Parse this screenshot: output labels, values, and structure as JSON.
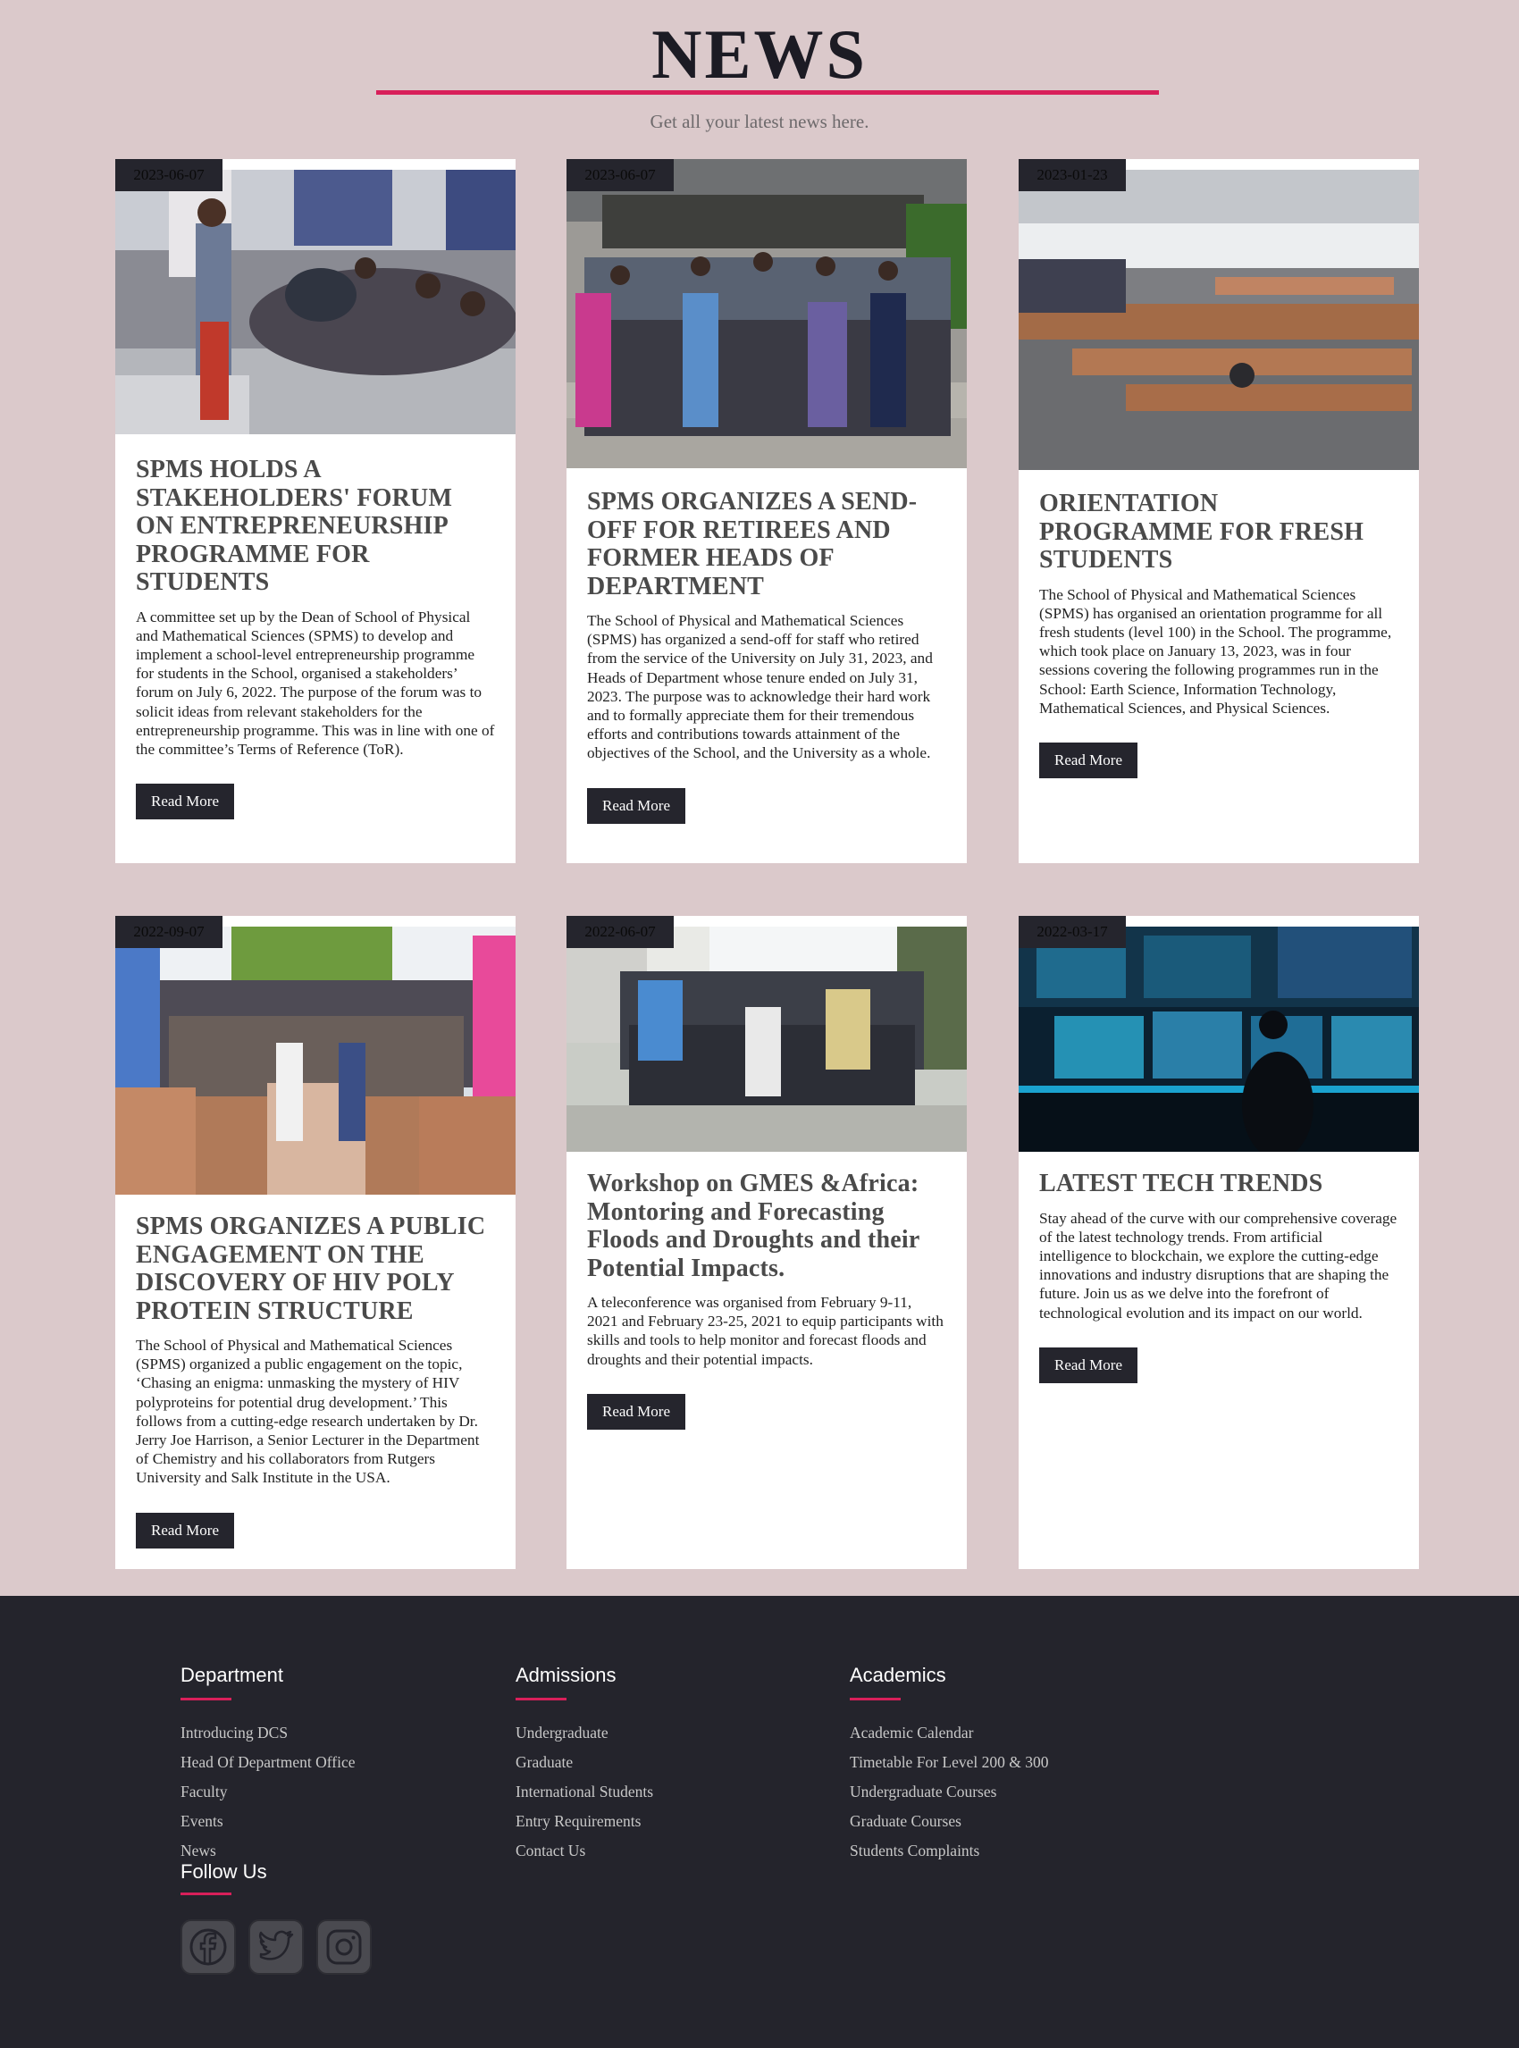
{
  "header": {
    "title": "NEWS",
    "subtitle": "Get all your latest news here."
  },
  "cards": [
    {
      "date": "2023-06-07",
      "title": "SPMS HOLDS A STAKEHOLDERS' FORUM ON ENTREPRENEURSHIP PROGRAMME FOR STUDENTS",
      "excerpt": "A committee set up by the Dean of School of Physical and Mathematical Sciences (SPMS) to develop and implement a school-level entrepreneurship programme for students in the School, organised a stakeholders’ forum on July 6, 2022. The purpose of the forum was to solicit ideas from relevant stakeholders for the entrepreneurship programme. This was in line with one of the committee’s Terms of Reference (ToR).",
      "button": "Read More"
    },
    {
      "date": "2023-06-07",
      "title": "SPMS ORGANIZES A SEND-OFF FOR RETIREES AND FORMER HEADS OF DEPARTMENT",
      "excerpt": "The School of Physical and Mathematical Sciences (SPMS) has organized a send-off for staff who retired from the service of the University on July 31, 2023, and Heads of Department whose tenure ended on July 31, 2023. The purpose was to acknowledge their hard work and to formally appreciate them for their tremendous efforts and contributions towards attainment of the objectives of the School, and the University as a whole.",
      "button": "Read More"
    },
    {
      "date": "2023-01-23",
      "title": "ORIENTATION PROGRAMME FOR FRESH STUDENTS",
      "excerpt": "The School of Physical and Mathematical Sciences (SPMS) has organised an orientation programme for all fresh students (level 100) in the School. The programme, which took place on January 13, 2023, was in four sessions covering the following programmes run in the School: Earth Science, Information Technology, Mathematical Sciences, and Physical Sciences.",
      "button": "Read More"
    },
    {
      "date": "2022-09-07",
      "title": "SPMS ORGANIZES A PUBLIC ENGAGEMENT ON THE DISCOVERY OF HIV POLY PROTEIN STRUCTURE",
      "excerpt": "The School of Physical and Mathematical Sciences (SPMS) organized a public engagement on the topic, ‘Chasing an enigma: unmasking the mystery of HIV polyproteins for potential drug development.’ This follows from a cutting-edge research undertaken by Dr. Jerry Joe Harrison, a Senior Lecturer in the Department of Chemistry and his collaborators from Rutgers University and Salk Institute in the USA.",
      "button": "Read More"
    },
    {
      "date": "2022-06-07",
      "title": "Workshop on GMES &Africa: Montoring and Forecasting Floods and Droughts and their Potential Impacts.",
      "excerpt": "A teleconference was organised from February 9-11, 2021 and February 23-25, 2021 to equip participants with skills and tools to help monitor and forecast floods and droughts and their potential impacts.",
      "button": "Read More"
    },
    {
      "date": "2022-03-17",
      "title": "LATEST TECH TRENDS",
      "excerpt": "Stay ahead of the curve with our comprehensive coverage of the latest technology trends. From artificial intelligence to blockchain, we explore the cutting-edge innovations and industry disruptions that are shaping the future. Join us as we delve into the forefront of technological evolution and its impact on our world.",
      "button": "Read More"
    }
  ],
  "footer": {
    "department": {
      "heading": "Department",
      "links": [
        "Introducing DCS",
        "Head Of Department Office",
        "Faculty",
        "Events",
        "News"
      ]
    },
    "admissions": {
      "heading": "Admissions",
      "links": [
        "Undergraduate",
        "Graduate",
        "International Students",
        "Entry Requirements",
        "Contact Us"
      ]
    },
    "academics": {
      "heading": "Academics",
      "links": [
        "Academic Calendar",
        "Timetable For Level 200 & 300",
        "Undergraduate Courses",
        "Graduate Courses",
        "Students Complaints"
      ]
    },
    "follow": {
      "heading": "Follow Us",
      "icons": [
        "facebook-icon",
        "twitter-icon",
        "instagram-icon"
      ]
    }
  },
  "colors": {
    "background": "#dbc9cb",
    "accent": "#d81f5a",
    "dark": "#25252d"
  }
}
